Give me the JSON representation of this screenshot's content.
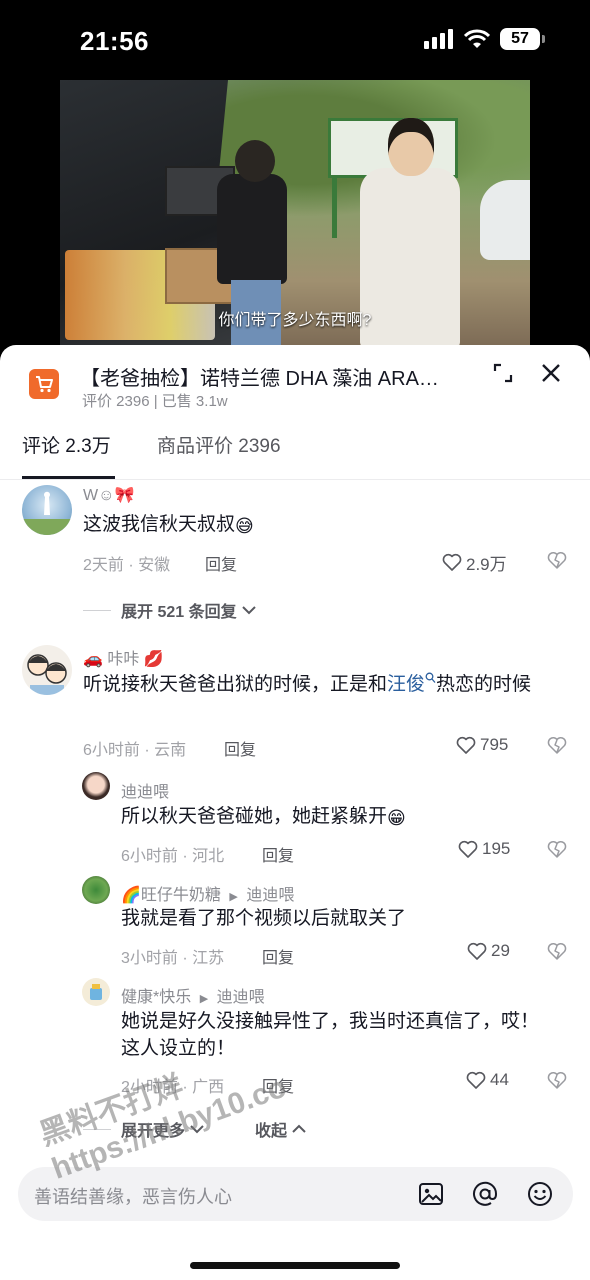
{
  "status_bar": {
    "time": "21:56",
    "battery": "57"
  },
  "video": {
    "subtitle": "你们带了多少东西啊?"
  },
  "product": {
    "title": "【老爸抽检】诺特兰德 DHA 藻油 ARA…",
    "stats": "评价 2396 | 已售 3.1w"
  },
  "tabs": [
    {
      "label": "评论 2.3万",
      "active": true
    },
    {
      "label": "商品评价 2396",
      "active": false
    }
  ],
  "comments": [
    {
      "name": "W☺🎀",
      "text": "这波我信秋天叔叔",
      "emoji": "😅",
      "time_location": "2天前 · 安徽",
      "reply_label": "回复",
      "likes": "2.9万",
      "expand_label": "展开 521 条回复"
    },
    {
      "name_prefix": "🚗",
      "name": "咔咔",
      "name_suffix": "💋",
      "text_before": "听说接秋天爸爸出狱的时候，正是和",
      "mention": "汪俊",
      "text_after": "热恋的时候",
      "time_location": "6小时前 · 云南",
      "reply_label": "回复",
      "likes": "795",
      "replies": [
        {
          "name": "迪迪喂",
          "text": "所以秋天爸爸碰她，她赶紧躲开",
          "emoji": "😁",
          "time_location": "6小时前 · 河北",
          "reply_label": "回复",
          "likes": "195"
        },
        {
          "name": "🌈旺仔牛奶糖",
          "reply_to": "迪迪喂",
          "text": "我就是看了那个视频以后就取关了",
          "time_location": "3小时前 · 江苏",
          "reply_label": "回复",
          "likes": "29"
        },
        {
          "name": "健康*快乐",
          "reply_to": "迪迪喂",
          "text": "她说是好久没接触异性了，我当时还真信了，哎！这人设立的！",
          "time_location": "2小时前 · 广西",
          "reply_label": "回复",
          "likes": "44"
        }
      ],
      "expand_more_label": "展开更多",
      "collapse_label": "收起"
    }
  ],
  "input": {
    "placeholder": "善语结善缘，恶言伤人心"
  },
  "watermark": {
    "line1": "黑料不打烊",
    "line2": "https://hl.by10.co"
  },
  "colors": {
    "accent": "#f06a2b",
    "mention": "#2b5f9e",
    "text": "#161823",
    "muted": "#8a8b91"
  }
}
